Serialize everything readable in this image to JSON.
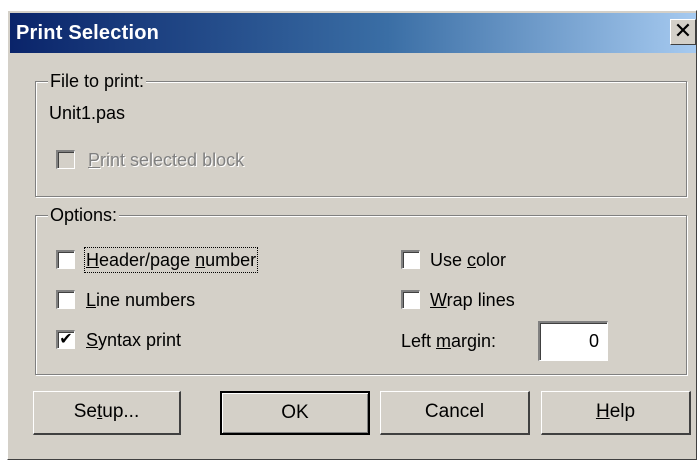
{
  "dialog": {
    "title": "Print Selection",
    "close_glyph": "✕"
  },
  "file_group": {
    "legend": "File to print:",
    "file_name": "Unit1.pas",
    "print_selected_block": {
      "label_accel": "P",
      "label_rest": "rint selected block",
      "checked": false,
      "enabled": false
    }
  },
  "options_group": {
    "legend": "Options:",
    "header_page_number": {
      "pre": "",
      "accel": "H",
      "post": "eader/page ",
      "accel2": "n",
      "post2": "umber",
      "checked": false
    },
    "line_numbers": {
      "accel": "L",
      "post": "ine numbers",
      "checked": false
    },
    "syntax_print": {
      "accel": "S",
      "post": "yntax print",
      "checked": true,
      "check_glyph": "✔"
    },
    "use_color": {
      "pre": "Use ",
      "accel": "c",
      "post": "olor",
      "checked": false
    },
    "wrap_lines": {
      "accel": "W",
      "post": "rap lines",
      "checked": false
    },
    "left_margin": {
      "pre": "Left ",
      "accel": "m",
      "post": "argin:",
      "value": "0"
    }
  },
  "buttons": {
    "setup": {
      "pre": "Se",
      "accel": "t",
      "post": "up..."
    },
    "ok": "OK",
    "cancel": "Cancel",
    "help": {
      "accel": "H",
      "post": "elp"
    }
  }
}
